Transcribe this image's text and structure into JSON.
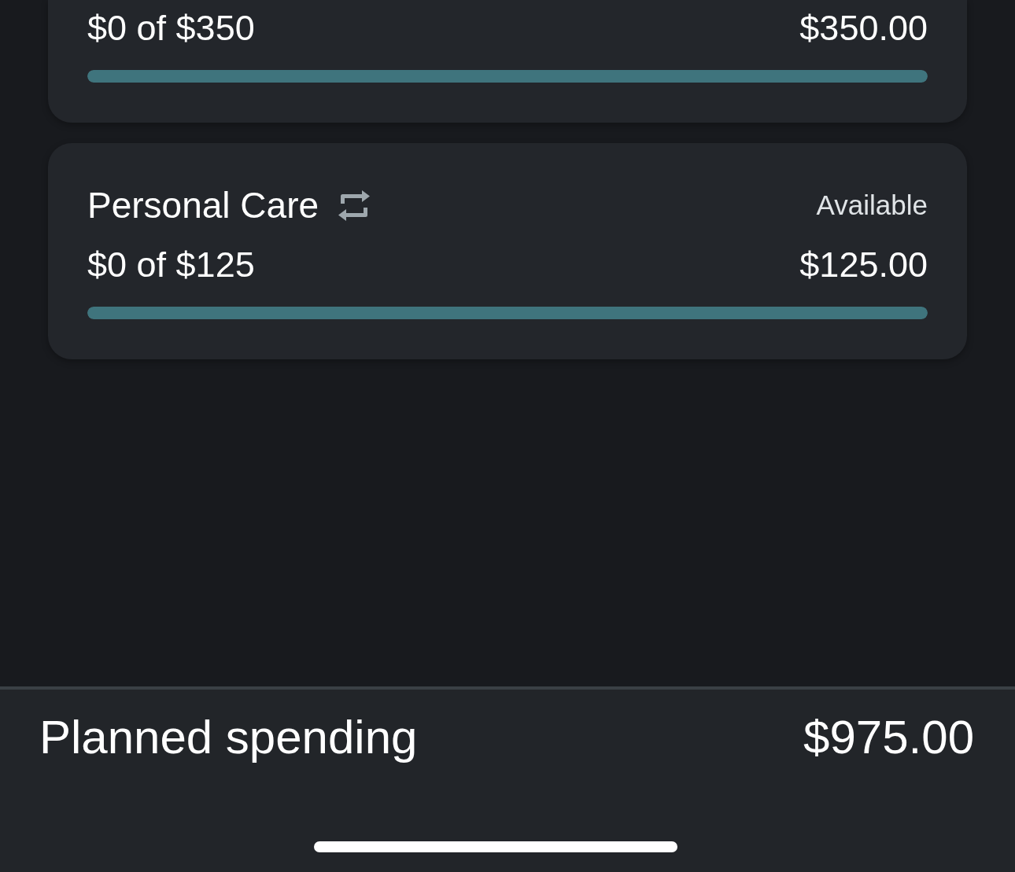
{
  "categories": [
    {
      "spent": "$0 of $350",
      "amount": "$350.00",
      "level": 1
    },
    {
      "name": "Personal Care",
      "recurring": true,
      "amount_label": "Available",
      "spent": "$0 of $125",
      "amount": "$125.00",
      "level": 1
    }
  ],
  "footer": {
    "label": "Planned spending",
    "total": "$975.00"
  }
}
